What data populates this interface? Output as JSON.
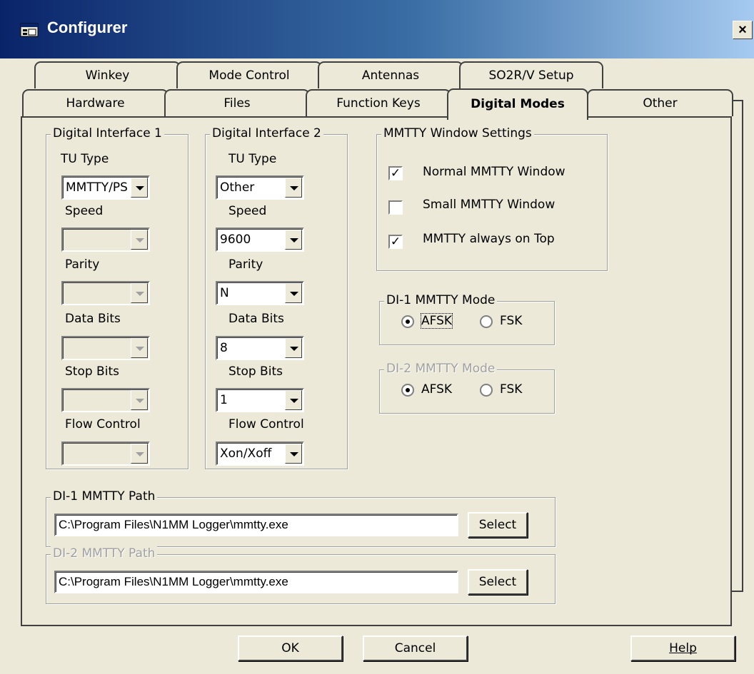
{
  "window": {
    "title": "Configurer",
    "close_glyph": "×"
  },
  "tabs": {
    "row1": [
      "Winkey",
      "Mode Control",
      "Antennas",
      "SO2R/V Setup"
    ],
    "row2": [
      "Hardware",
      "Files",
      "Function Keys",
      "Digital Modes",
      "Other"
    ],
    "active": "Digital Modes"
  },
  "di1": {
    "legend": "Digital Interface 1",
    "tu_type_label": "TU Type",
    "tu_type_value": "MMTTY/PS",
    "speed_label": "Speed",
    "speed_value": "",
    "parity_label": "Parity",
    "parity_value": "",
    "data_bits_label": "Data Bits",
    "data_bits_value": "",
    "stop_bits_label": "Stop Bits",
    "stop_bits_value": "",
    "flow_control_label": "Flow Control",
    "flow_control_value": ""
  },
  "di2": {
    "legend": "Digital Interface 2",
    "tu_type_label": "TU Type",
    "tu_type_value": "Other",
    "speed_label": "Speed",
    "speed_value": "9600",
    "parity_label": "Parity",
    "parity_value": "N",
    "data_bits_label": "Data Bits",
    "data_bits_value": "8",
    "stop_bits_label": "Stop Bits",
    "stop_bits_value": "1",
    "flow_control_label": "Flow Control",
    "flow_control_value": "Xon/Xoff"
  },
  "mmtty_window": {
    "legend": "MMTTY Window Settings",
    "normal_label": "Normal MMTTY Window",
    "normal_checked": true,
    "small_label": "Small MMTTY Window",
    "small_checked": false,
    "on_top_label": "MMTTY always on Top",
    "on_top_checked": true,
    "check_glyph": "✓"
  },
  "di1_mode": {
    "legend": "DI-1 MMTTY Mode",
    "afsk_label": "AFSK",
    "fsk_label": "FSK",
    "selected": "AFSK"
  },
  "di2_mode": {
    "legend": "DI-2 MMTTY Mode",
    "afsk_label": "AFSK",
    "fsk_label": "FSK",
    "selected": "AFSK"
  },
  "di1_path": {
    "legend": "DI-1 MMTTY Path",
    "value": "C:\\Program Files\\N1MM Logger\\mmtty.exe",
    "select_label": "Select"
  },
  "di2_path": {
    "legend": "DI-2 MMTTY Path",
    "value": "C:\\Program Files\\N1MM Logger\\mmtty.exe",
    "select_label": "Select"
  },
  "buttons": {
    "ok": "OK",
    "cancel": "Cancel",
    "help": "Help"
  }
}
